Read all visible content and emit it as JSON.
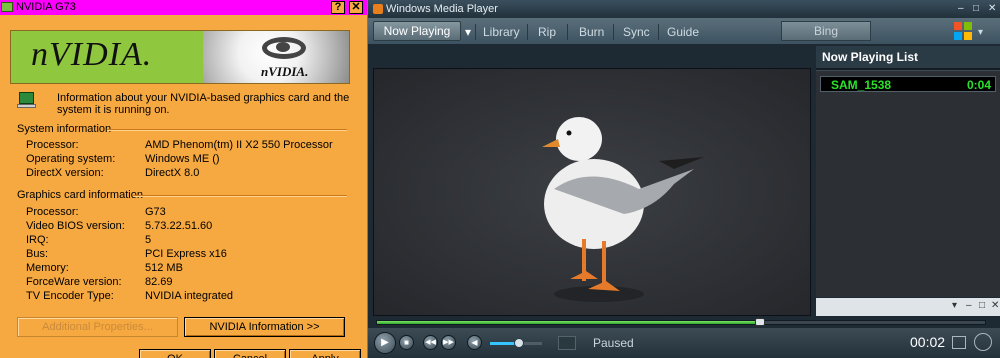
{
  "nvidia": {
    "title": "NVIDIA G73",
    "title_buttons": {
      "help": "?",
      "close": "✕"
    },
    "banner": {
      "wordmark": "nVIDIA.",
      "logo_text": "nVIDIA."
    },
    "info_text": "Information about your NVIDIA-based graphics card and the system it is running on.",
    "system_info": {
      "heading": "System information",
      "rows": [
        {
          "label": "Processor:",
          "value": "AMD Phenom(tm) II X2 550 Processor"
        },
        {
          "label": "Operating system:",
          "value": "Windows ME ()"
        },
        {
          "label": "DirectX version:",
          "value": "DirectX 8.0"
        }
      ]
    },
    "graphics_info": {
      "heading": "Graphics card information",
      "rows": [
        {
          "label": "Processor:",
          "value": "G73"
        },
        {
          "label": "Video BIOS version:",
          "value": "5.73.22.51.60"
        },
        {
          "label": "IRQ:",
          "value": "5"
        },
        {
          "label": "Bus:",
          "value": "PCI Express x16"
        },
        {
          "label": "Memory:",
          "value": "512 MB"
        },
        {
          "label": "ForceWare version:",
          "value": "82.69"
        },
        {
          "label": "TV Encoder Type:",
          "value": "NVIDIA integrated"
        }
      ]
    },
    "buttons": {
      "additional": "Additional Properties...",
      "nvidia_info": "NVIDIA Information >>",
      "ok": "OK",
      "cancel": "Cancel",
      "apply": "Apply"
    }
  },
  "wmp": {
    "title": "Windows Media Player",
    "window_controls": {
      "minimize": "–",
      "restore": "□",
      "close": "✕"
    },
    "tabs": [
      "Now Playing",
      "Library",
      "Rip",
      "Burn",
      "Sync",
      "Guide"
    ],
    "tab_dropdown": "▾",
    "bing_label": "Bing",
    "logo_colors": [
      "#f35325",
      "#81bc06",
      "#05a6f0",
      "#ffba08"
    ],
    "now_playing_list": {
      "title": "Now Playing List",
      "items": [
        {
          "name": "SAM_1538",
          "duration": "0:04"
        }
      ],
      "footer_controls": {
        "dropdown": "▾",
        "minimize": "–",
        "restore": "□",
        "close": "✕"
      }
    },
    "seek_fraction": 0.63,
    "volume_fraction": 0.55,
    "status": "Paused",
    "time": "00:02",
    "accent_green": "#2be22b"
  }
}
